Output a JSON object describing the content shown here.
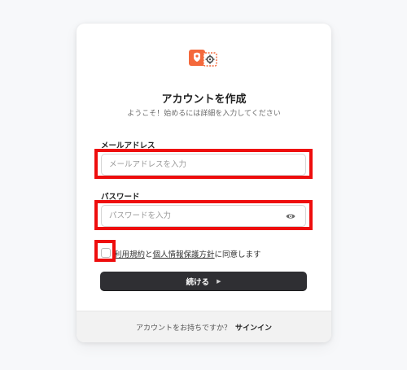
{
  "app": {
    "title": "アカウントを作成",
    "subtitle": "ようこそ！始めるには詳細を入力してください",
    "logo_icon": "fox-gear-logo",
    "accent_color": "#f4693c"
  },
  "form": {
    "email_label": "メールアドレス",
    "email_placeholder": "メールアドレスを入力",
    "email_value": "",
    "password_label": "パスワード",
    "password_placeholder": "パスワードを入力",
    "password_value": "",
    "password_toggle_icon": "eye-icon",
    "agree_terms": "利用規約",
    "agree_and": "と",
    "agree_privacy": "個人情報保護方針",
    "agree_suffix": "に同意します",
    "agree_checked": false,
    "continue_label": "続ける",
    "continue_icon": "play-arrow-icon"
  },
  "footer": {
    "prompt": "アカウントをお持ちですか？",
    "signin_label": "サインイン"
  },
  "highlight_color": "#ee0d0d"
}
